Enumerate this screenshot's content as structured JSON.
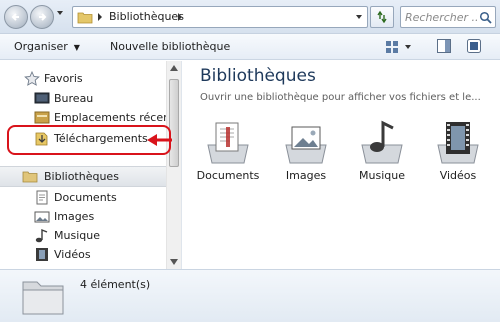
{
  "address_bar": {
    "crumb": "Bibliothèques",
    "search_placeholder": "Rechercher ..."
  },
  "command_bar": {
    "organize_label": "Organiser",
    "new_library_label": "Nouvelle bibliothèque"
  },
  "nav": {
    "favorites_label": "Favoris",
    "favorites": [
      "Bureau",
      "Emplacements récents",
      "Téléchargements"
    ],
    "libraries_label": "Bibliothèques",
    "libraries": [
      "Documents",
      "Images",
      "Musique",
      "Vidéos"
    ]
  },
  "content": {
    "title": "Bibliothèques",
    "subtitle": "Ouvrir une bibliothèque pour afficher vos fichiers et le...",
    "tiles": [
      "Documents",
      "Images",
      "Musique",
      "Vidéos"
    ]
  },
  "details": {
    "count": "4 élément(s)"
  },
  "colors": {
    "annotation_red": "#d9131b",
    "title_blue": "#1e395b"
  },
  "icons": [
    "back-icon",
    "forward-icon",
    "folder-icon",
    "refresh-icon",
    "search-icon",
    "star-icon",
    "desktop-icon",
    "recent-places-icon",
    "downloads-icon",
    "library-icon",
    "document-icon",
    "image-icon",
    "music-icon",
    "video-icon"
  ]
}
